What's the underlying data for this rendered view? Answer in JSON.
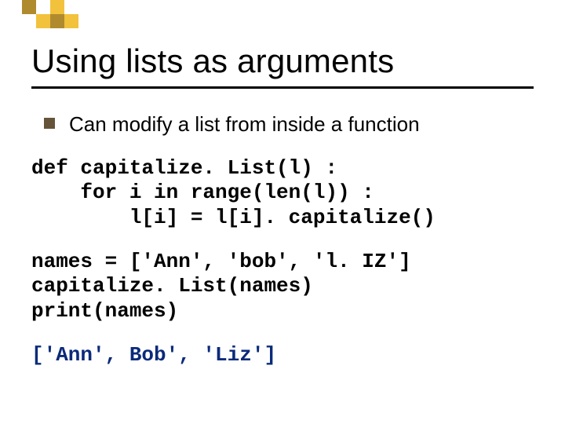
{
  "title": "Using lists as arguments",
  "bullet": "Can modify a list from inside a function",
  "code1_line1": "def capitalize. List(l) :",
  "code1_line2": "    for i in range(len(l)) :",
  "code1_line3": "        l[i] = l[i]. capitalize()",
  "code2_line1": "names = ['Ann', 'bob', 'l. IZ']",
  "code2_line2": "capitalize. List(names)",
  "code2_line3": "print(names)",
  "output": "['Ann', Bob', 'Liz']"
}
